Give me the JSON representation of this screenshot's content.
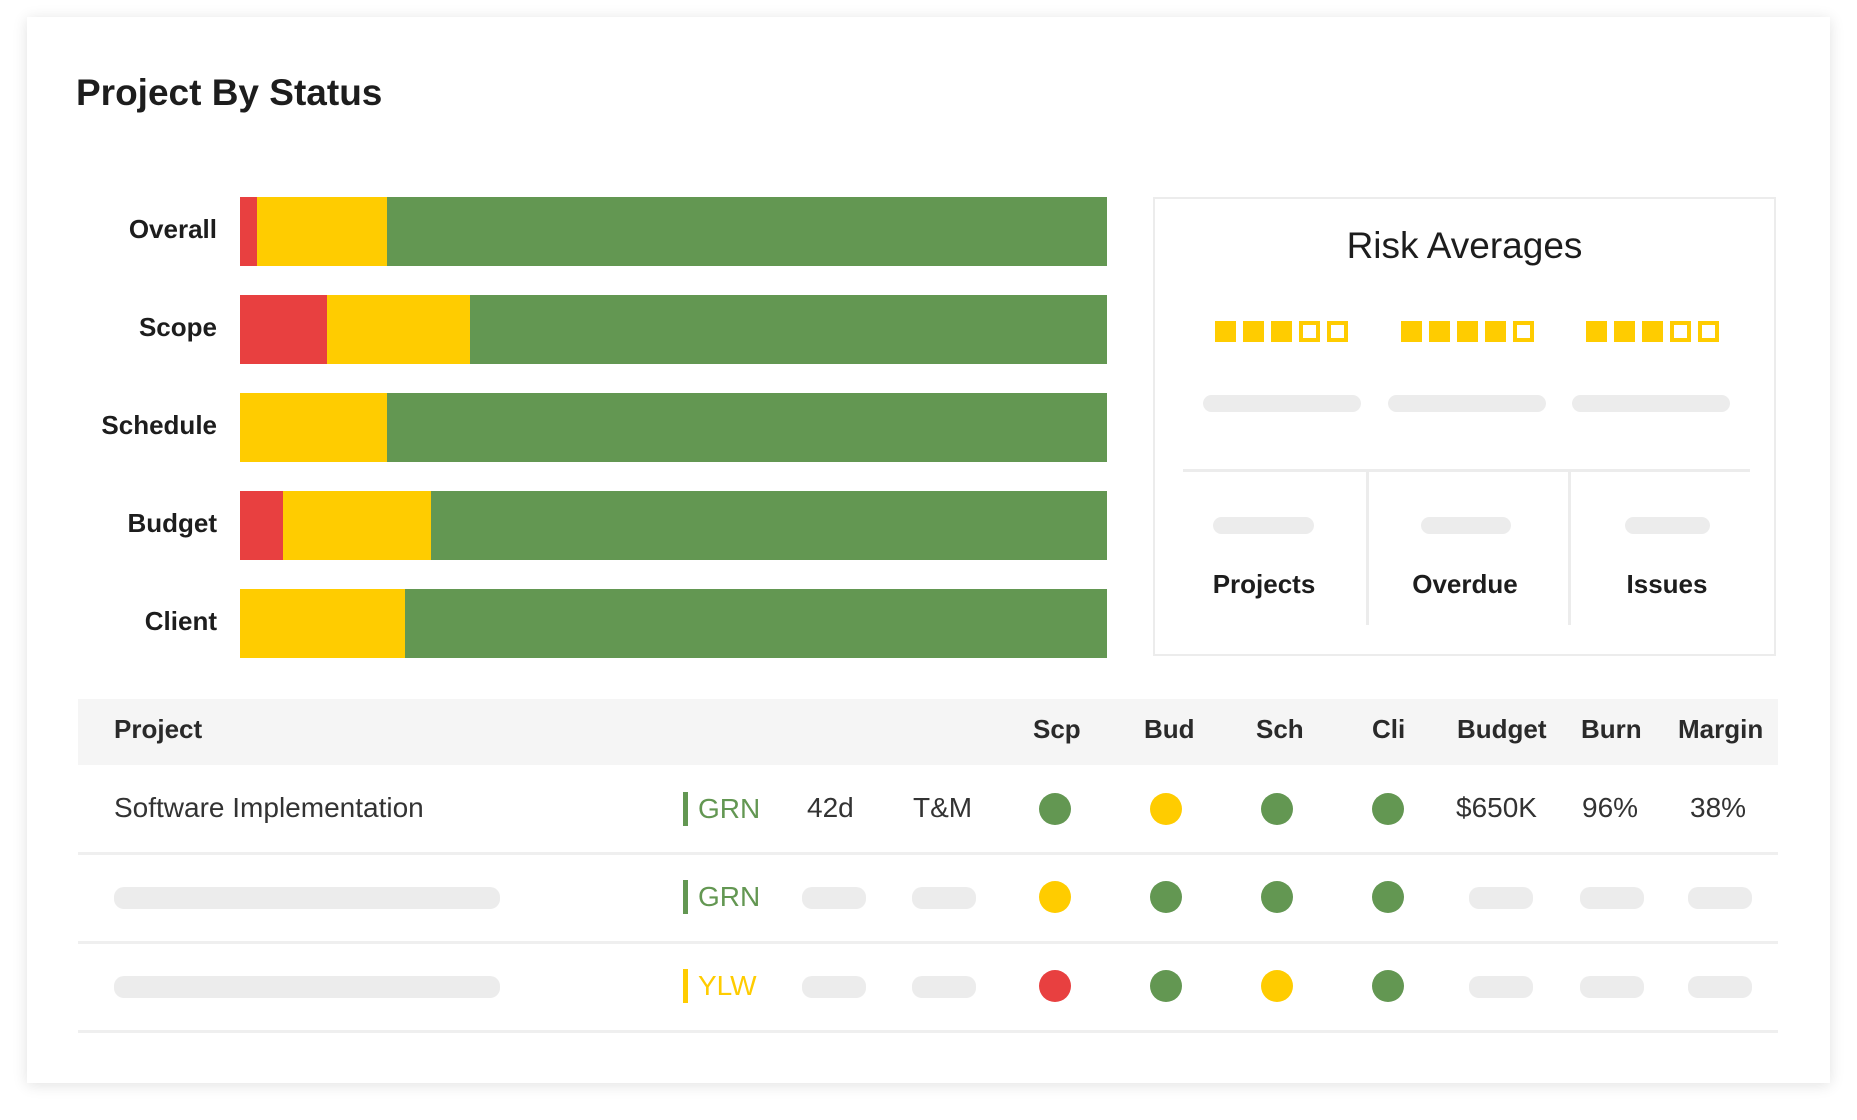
{
  "page_title": "Project By Status",
  "colors": {
    "red": "#e84040",
    "yellow": "#ffcc00",
    "green": "#639752",
    "placeholder": "#ececec"
  },
  "chart_data": {
    "type": "bar",
    "stacked": true,
    "orientation": "horizontal",
    "categories": [
      "Overall",
      "Scope",
      "Schedule",
      "Budget",
      "Client"
    ],
    "series": [
      {
        "color": "#e84040",
        "values": [
          2,
          10,
          0,
          5,
          0
        ]
      },
      {
        "color": "#ffcc00",
        "values": [
          15,
          16.5,
          17,
          17,
          19
        ]
      },
      {
        "color": "#639752",
        "values": [
          83,
          73.5,
          83,
          78,
          81
        ]
      }
    ],
    "xlim": [
      0,
      100
    ]
  },
  "risk_panel": {
    "title": "Risk Averages",
    "ratings": [
      {
        "filled": 3,
        "total": 5
      },
      {
        "filled": 4,
        "total": 5
      },
      {
        "filled": 3,
        "total": 5
      }
    ],
    "stats": [
      {
        "label": "Projects"
      },
      {
        "label": "Overdue"
      },
      {
        "label": "Issues"
      }
    ]
  },
  "table": {
    "headers": {
      "project": "Project",
      "scp": "Scp",
      "bud": "Bud",
      "sch": "Sch",
      "cli": "Cli",
      "budget": "Budget",
      "burn": "Burn",
      "margin": "Margin"
    },
    "rows": [
      {
        "project": "Software Implementation",
        "status": "GRN",
        "status_color": "#639752",
        "days": "42d",
        "type": "T&M",
        "scp": "green",
        "bud": "yellow",
        "sch": "green",
        "cli": "green",
        "budget": "$650K",
        "burn": "96%",
        "margin": "38%"
      },
      {
        "project": null,
        "status": "GRN",
        "status_color": "#639752",
        "scp": "yellow",
        "bud": "green",
        "sch": "green",
        "cli": "green"
      },
      {
        "project": null,
        "status": "YLW",
        "status_color": "#ffcc00",
        "scp": "red",
        "bud": "green",
        "sch": "yellow",
        "cli": "green"
      }
    ]
  }
}
